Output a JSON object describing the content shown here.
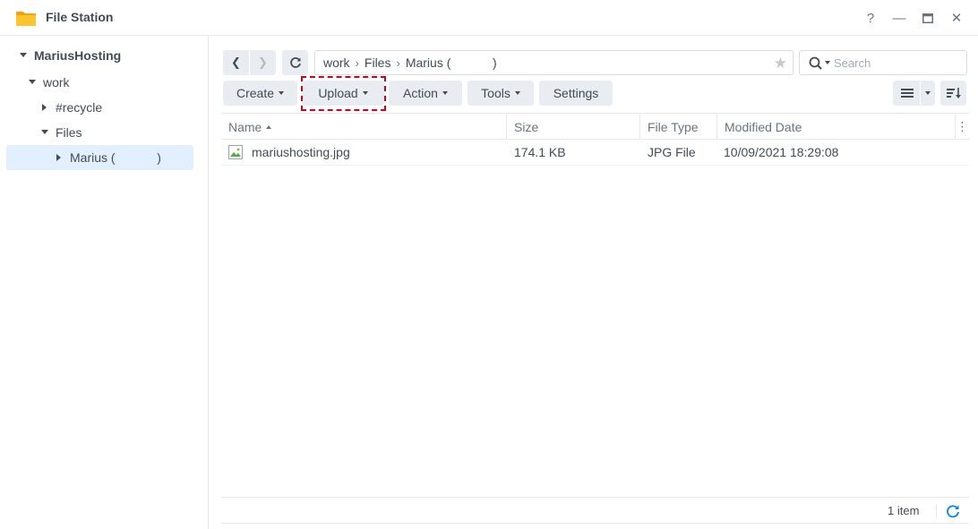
{
  "window": {
    "title": "File Station",
    "icons": {
      "app": "folder-icon",
      "help": "help-icon",
      "minimize": "minimize-icon",
      "maximize": "maximize-icon",
      "close": "close-icon"
    },
    "help_glyph": "?",
    "min_glyph": "—",
    "close_glyph": "✕"
  },
  "sidebar": {
    "root": "MariusHosting",
    "items": [
      {
        "label": "work",
        "state": "expanded"
      },
      {
        "label": "#recycle",
        "state": "collapsed"
      },
      {
        "label": "Files",
        "state": "expanded"
      },
      {
        "label": "Marius (            )",
        "state": "collapsed",
        "selected": true
      }
    ]
  },
  "navigation": {
    "back_glyph": "❮",
    "forward_glyph": "❯",
    "path": [
      "work",
      "Files",
      "Marius (            )"
    ],
    "path_separator": "›",
    "star_glyph": "★"
  },
  "search": {
    "placeholder": "Search"
  },
  "toolbar": {
    "create": "Create",
    "upload": "Upload",
    "action": "Action",
    "tools": "Tools",
    "settings": "Settings"
  },
  "grid": {
    "columns": [
      "Name",
      "Size",
      "File Type",
      "Modified Date"
    ],
    "sort_column": "Name",
    "sort_direction": "ascending",
    "menu_glyph": "⋮",
    "rows": [
      {
        "name": "mariushosting.jpg",
        "size": "174.1 KB",
        "type": "JPG File",
        "modified": "10/09/2021 18:29:08",
        "icon": "image-file-icon"
      }
    ]
  },
  "footer": {
    "item_count": "1 item"
  },
  "colors": {
    "accent": "#0086e5",
    "highlight_box": "#d0021b",
    "selected_bg": "#e2efff",
    "button_bg": "#e9edf1",
    "folder": "#f5b315"
  }
}
